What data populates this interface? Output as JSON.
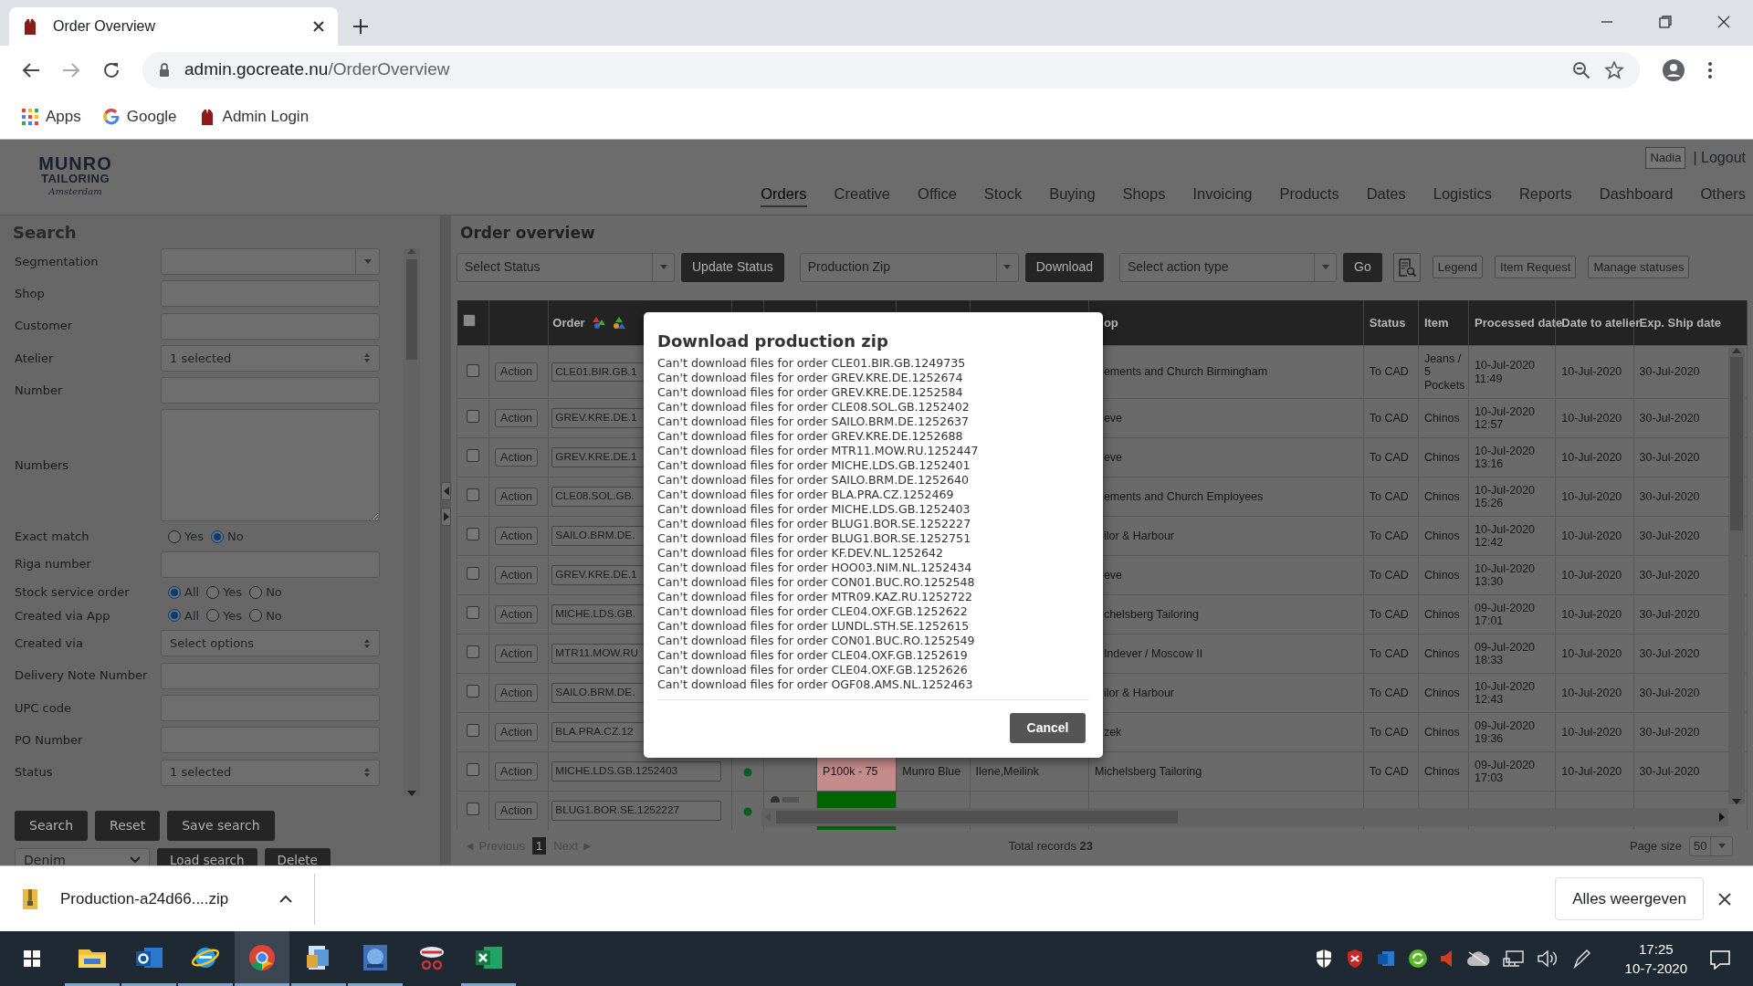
{
  "browser": {
    "tab_title": "Order Overview",
    "url_host": "admin.gocreate.nu",
    "url_path": "/OrderOverview",
    "bookmarks": [
      {
        "kind": "apps",
        "label": "Apps"
      },
      {
        "kind": "google",
        "label": "Google"
      },
      {
        "kind": "jacket",
        "label": "Admin Login"
      }
    ]
  },
  "header": {
    "logo_lines": [
      "MUNRO",
      "TAILORING",
      "Amsterdam"
    ],
    "user": "Nadia",
    "logout": "| Logout"
  },
  "nav": [
    {
      "label": "Orders",
      "selected": true
    },
    {
      "label": "Creative",
      "selected": false
    },
    {
      "label": "Office",
      "selected": false
    },
    {
      "label": "Stock",
      "selected": false
    },
    {
      "label": "Buying",
      "selected": false
    },
    {
      "label": "Shops",
      "selected": false
    },
    {
      "label": "Invoicing",
      "selected": false
    },
    {
      "label": "Products",
      "selected": false
    },
    {
      "label": "Dates",
      "selected": false
    },
    {
      "label": "Logistics",
      "selected": false
    },
    {
      "label": "Reports",
      "selected": false
    },
    {
      "label": "Dashboard",
      "selected": false
    },
    {
      "label": "Others",
      "selected": false
    }
  ],
  "search_panel": {
    "title": "Search",
    "fields": [
      {
        "label": "Segmentation",
        "kind": "combo"
      },
      {
        "label": "Shop",
        "kind": "text"
      },
      {
        "label": "Customer",
        "kind": "text"
      },
      {
        "label": "Atelier",
        "kind": "select",
        "value": "1 selected"
      },
      {
        "label": "Number",
        "kind": "text"
      },
      {
        "label": "Numbers",
        "kind": "textarea"
      },
      {
        "label": "Exact match",
        "kind": "radio",
        "options": [
          {
            "label": "Yes",
            "selected": false
          },
          {
            "label": "No",
            "selected": true
          }
        ]
      },
      {
        "label": "Riga number",
        "kind": "text"
      },
      {
        "label": "Stock service order",
        "kind": "radio",
        "options": [
          {
            "label": "All",
            "selected": true
          },
          {
            "label": "Yes",
            "selected": false
          },
          {
            "label": "No",
            "selected": false
          }
        ]
      },
      {
        "label": "Created via App",
        "kind": "radio",
        "options": [
          {
            "label": "All",
            "selected": true
          },
          {
            "label": "Yes",
            "selected": false
          },
          {
            "label": "No",
            "selected": false
          }
        ]
      },
      {
        "label": "Created via",
        "kind": "select",
        "value": "Select options"
      },
      {
        "label": "Delivery Note Number",
        "kind": "text"
      },
      {
        "label": "UPC code",
        "kind": "text"
      },
      {
        "label": "PO Number",
        "kind": "text"
      },
      {
        "label": "Status",
        "kind": "select",
        "value": "1 selected"
      }
    ],
    "buttons": [
      "Search",
      "Reset",
      "Save search"
    ],
    "saved_search": "Denim",
    "saved_buttons": [
      "Load search",
      "Delete"
    ]
  },
  "content": {
    "title": "Order overview",
    "toolbar": [
      {
        "kind": "combo",
        "label": "Select Status"
      },
      {
        "kind": "dark",
        "label": "Update Status"
      },
      {
        "kind": "combo",
        "label": "Production Zip"
      },
      {
        "kind": "dark",
        "label": "Download"
      },
      {
        "kind": "combo",
        "label": "Select action type"
      },
      {
        "kind": "dark",
        "label": "Go"
      },
      {
        "kind": "icon"
      },
      {
        "kind": "light",
        "label": "Legend"
      },
      {
        "kind": "light",
        "label": "Item Request"
      },
      {
        "kind": "light",
        "label": "Manage statuses"
      }
    ]
  },
  "table": {
    "all_checked": false,
    "columns": [
      "Order",
      "op",
      "Status",
      "Item",
      "Processed date",
      "Date to atelier",
      "Exp. Ship date"
    ],
    "rows": [
      {
        "checked": false,
        "action": "Action",
        "order": "CLE01.BIR.GB.1",
        "shop": "ements and Church Birmingham",
        "status": "To CAD",
        "item": "Jeans / 5 Pockets",
        "processed": "10-Jul-2020 11:49",
        "to_atelier": "10-Jul-2020",
        "ship": "30-Jul-2020"
      },
      {
        "checked": false,
        "action": "Action",
        "order": "GREV.KRE.DE.1",
        "shop": "eve",
        "status": "To CAD",
        "item": "Chinos",
        "processed": "10-Jul-2020 12:57",
        "to_atelier": "10-Jul-2020",
        "ship": "30-Jul-2020"
      },
      {
        "checked": false,
        "action": "Action",
        "order": "GREV.KRE.DE.1",
        "shop": "eve",
        "status": "To CAD",
        "item": "Chinos",
        "processed": "10-Jul-2020 13:16",
        "to_atelier": "10-Jul-2020",
        "ship": "30-Jul-2020"
      },
      {
        "checked": false,
        "action": "Action",
        "order": "CLE08.SOL.GB.",
        "shop": "ements and Church Employees",
        "status": "To CAD",
        "item": "Chinos",
        "processed": "10-Jul-2020 15:26",
        "to_atelier": "10-Jul-2020",
        "ship": "30-Jul-2020"
      },
      {
        "checked": false,
        "action": "Action",
        "order": "SAILO.BRM.DE.",
        "shop": "ilor & Harbour",
        "status": "To CAD",
        "item": "Chinos",
        "processed": "10-Jul-2020 12:42",
        "to_atelier": "10-Jul-2020",
        "ship": "30-Jul-2020"
      },
      {
        "checked": false,
        "action": "Action",
        "order": "GREV.KRE.DE.1",
        "shop": "eve",
        "status": "To CAD",
        "item": "Chinos",
        "processed": "10-Jul-2020 13:30",
        "to_atelier": "10-Jul-2020",
        "ship": "30-Jul-2020"
      },
      {
        "checked": false,
        "action": "Action",
        "order": "MICHE.LDS.GB.",
        "shop": "chelsberg Tailoring",
        "status": "To CAD",
        "item": "Chinos",
        "processed": "09-Jul-2020 17:01",
        "to_atelier": "10-Jul-2020",
        "ship": "30-Jul-2020"
      },
      {
        "checked": false,
        "action": "Action",
        "order": "MTR11.MOW.RU",
        "shop": "Indever / Moscow II",
        "status": "To CAD",
        "item": "Chinos",
        "processed": "09-Jul-2020 18:33",
        "to_atelier": "10-Jul-2020",
        "ship": "30-Jul-2020"
      },
      {
        "checked": false,
        "action": "Action",
        "order": "SAILO.BRM.DE.",
        "shop": "ilor & Harbour",
        "status": "To CAD",
        "item": "Chinos",
        "processed": "10-Jul-2020 12:43",
        "to_atelier": "10-Jul-2020",
        "ship": "30-Jul-2020"
      },
      {
        "checked": false,
        "action": "Action",
        "order": "BLA.PRA.CZ.12",
        "shop": "zek",
        "status": "To CAD",
        "item": "Chinos",
        "processed": "09-Jul-2020 19:36",
        "to_atelier": "10-Jul-2020",
        "ship": "30-Jul-2020"
      },
      {
        "checked": false,
        "action": "Action",
        "order": "MICHE.LDS.GB.1252403",
        "dot": true,
        "column_6": "P100k - 75",
        "column_7": "Munro Blue",
        "column_8": "Ilene,Meilink",
        "shop": "Michelsberg Tailoring",
        "status": "To CAD",
        "item": "Chinos",
        "processed": "09-Jul-2020 17:03",
        "to_atelier": "10-Jul-2020",
        "ship": "30-Jul-2020"
      },
      {
        "checked": false,
        "action": "Action",
        "order": "BLUG1.BOR.SE.1252227",
        "dot": true
      }
    ]
  },
  "pager": {
    "previous": "◄ Previous",
    "page": "1",
    "next": "Next ►",
    "total": "Total records **23**",
    "page_size_label": "Page size",
    "page_size": "50"
  },
  "modal": {
    "title": "Download production zip",
    "lines": [
      "Can't download files for order CLE01.BIR.GB.1249735",
      "Can't download files for order GREV.KRE.DE.1252674",
      "Can't download files for order GREV.KRE.DE.1252584",
      "Can't download files for order CLE08.SOL.GB.1252402",
      "Can't download files for order SAILO.BRM.DE.1252637",
      "Can't download files for order GREV.KRE.DE.1252688",
      "Can't download files for order MTR11.MOW.RU.1252447",
      "Can't download files for order MICHE.LDS.GB.1252401",
      "Can't download files for order SAILO.BRM.DE.1252640",
      "Can't download files for order BLA.PRA.CZ.1252469",
      "Can't download files for order MICHE.LDS.GB.1252403",
      "Can't download files for order BLUG1.BOR.SE.1252227",
      "Can't download files for order BLUG1.BOR.SE.1252751",
      "Can't download files for order KF.DEV.NL.1252642",
      "Can't download files for order HOO03.NIM.NL.1252434",
      "Can't download files for order CON01.BUC.RO.1252548",
      "Can't download files for order MTR09.KAZ.RU.1252722",
      "Can't download files for order CLE04.OXF.GB.1252622",
      "Can't download files for order LUNDL.STH.SE.1252615",
      "Can't download files for order CON01.BUC.RO.1252549",
      "Can't download files for order CLE04.OXF.GB.1252619",
      "Can't download files for order CLE04.OXF.GB.1252626",
      "Can't download files for order OGF08.AMS.NL.1252463"
    ],
    "button": "Cancel"
  },
  "download_bar": {
    "file": "Production-a24d66....zip",
    "show_all": "Alles weergeven"
  },
  "taskbar": {
    "apps": [
      {
        "kind": "folder",
        "running": true,
        "selected": false
      },
      {
        "kind": "outlook",
        "running": true,
        "selected": false
      },
      {
        "kind": "ie",
        "running": true,
        "selected": false
      },
      {
        "kind": "chrome",
        "running": true,
        "selected": true
      },
      {
        "kind": "document",
        "running": true,
        "selected": false
      },
      {
        "kind": "blue",
        "running": true,
        "selected": false
      },
      {
        "kind": "scissors",
        "running": false,
        "selected": false
      },
      {
        "kind": "excel",
        "running": true,
        "selected": false
      }
    ],
    "time": "17:25",
    "date": "10-7-2020"
  }
}
